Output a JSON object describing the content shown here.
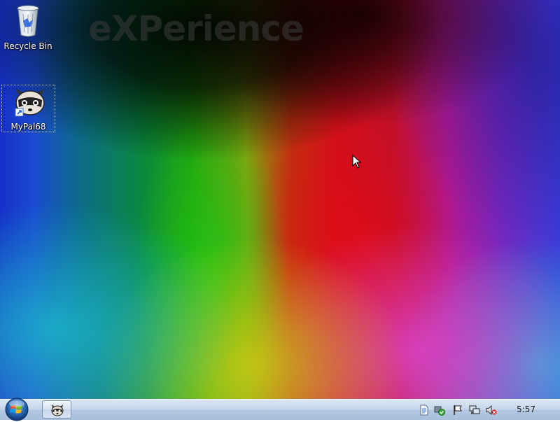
{
  "desktop": {
    "watermark": "eXPerience",
    "icons": [
      {
        "label": "Recycle Bin",
        "icon": "recycle-bin-icon"
      },
      {
        "label": "MyPal68",
        "icon": "mypal-raccoon-icon"
      }
    ]
  },
  "taskbar": {
    "start_icon": "windows-orb-icon",
    "tasks": [
      {
        "icon": "mypal-raccoon-icon"
      }
    ],
    "tray_icons": [
      "document-icon",
      "security-check-icon",
      "flag-icon",
      "network-icon",
      "volume-muted-icon"
    ],
    "clock": "5:57"
  },
  "colors": {
    "taskbar_top": "#dbe6f2",
    "taskbar_bottom": "#a8bfdb",
    "start_orb": "#2a6ab8"
  }
}
